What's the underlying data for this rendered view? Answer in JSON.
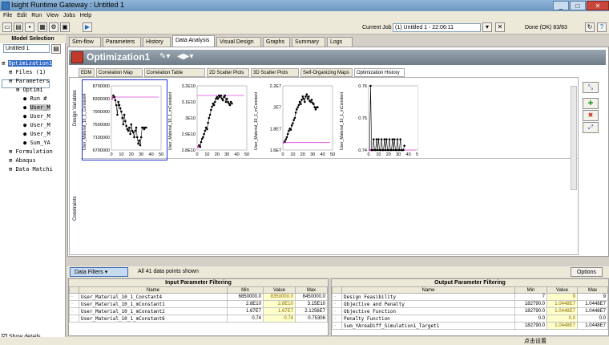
{
  "window": {
    "title": "Isight Runtime Gateway : Untitled 1"
  },
  "menu": [
    "File",
    "Edit",
    "Run",
    "View",
    "Jobs",
    "Help"
  ],
  "toolbar": {
    "current_job_label": "Current Job",
    "current_job_value": "(1) Untitled 1 - 22:06:11",
    "status": "Done (OK) 83/83"
  },
  "left": {
    "title": "Model Selection",
    "model_select": "Untitled 1",
    "tree": [
      {
        "label": "Optimization1",
        "indent": 0,
        "sel": true
      },
      {
        "label": "Files (1)",
        "indent": 1
      },
      {
        "label": "Parameters",
        "indent": 1
      },
      {
        "label": "Optimi",
        "indent": 2
      },
      {
        "label": "Run #",
        "indent": 3
      },
      {
        "label": "User_M",
        "indent": 3,
        "hl": true
      },
      {
        "label": "User_M",
        "indent": 3
      },
      {
        "label": "User_M",
        "indent": 3
      },
      {
        "label": "User_M",
        "indent": 3
      },
      {
        "label": "Sum_YA",
        "indent": 3
      },
      {
        "label": "Formulation",
        "indent": 1
      },
      {
        "label": "Abaqus",
        "indent": 1
      },
      {
        "label": "Data Matchi",
        "indent": 1
      }
    ],
    "show_details": "Show details"
  },
  "tabs": [
    "Sim-flow",
    "Parameters",
    "History",
    "Data Analysis",
    "Visual Design",
    "Graphs",
    "Summary",
    "Logs"
  ],
  "active_tab": "Data Analysis",
  "component_title": "Optimization1",
  "subtabs": [
    "EDM",
    "Correlation Map",
    "Correlation Table",
    "2D Scatter Plots",
    "3D Scatter Plots",
    "Self-Organizing Maps",
    "Optimization History"
  ],
  "active_subtab": "Optimization History",
  "side_labels": {
    "design": "Design Variables",
    "constraints": "Constraints"
  },
  "chart_data": [
    {
      "type": "scatter",
      "ylabel": "User_Material_10_1_Constant4",
      "yticks": [
        "8700000",
        "8300000",
        "7900000",
        "7500000",
        "7100000",
        "6700000"
      ],
      "ylim": [
        6700000,
        8700000
      ],
      "xticks": [
        "0",
        "10",
        "20",
        "30",
        "40",
        "50"
      ],
      "xlim": [
        0,
        50
      ],
      "ref": 8350000,
      "x": [
        1,
        2,
        3,
        4,
        5,
        6,
        7,
        8,
        9,
        10,
        11,
        12,
        13,
        14,
        15,
        16,
        17,
        18,
        19,
        20,
        21,
        22,
        23,
        24,
        25,
        26,
        27,
        28,
        29,
        30,
        31,
        32,
        33,
        34,
        35
      ],
      "y": [
        8300000,
        8400000,
        8350000,
        8250000,
        8100000,
        7800000,
        8200000,
        8100000,
        8000000,
        7900000,
        7700000,
        7500000,
        7800000,
        7600000,
        7450000,
        7350000,
        7300000,
        7400000,
        7200000,
        7500000,
        7300000,
        7250000,
        7100000,
        7300000,
        7400000,
        7100000,
        6900000,
        7000000,
        6850000,
        7100000,
        7400000,
        7400000,
        7350000,
        7400000,
        7400000
      ]
    },
    {
      "type": "scatter",
      "ylabel": "User_Material_10_1_mConstant",
      "yticks": [
        "3.2E10",
        "3.1E10",
        "3E10",
        "2.9E10",
        "2.8E10"
      ],
      "ylim": [
        28000000000.0,
        32000000000.0
      ],
      "xticks": [
        "0",
        "10",
        "20",
        "30",
        "40",
        "50"
      ],
      "xlim": [
        0,
        50
      ],
      "ref": 31400000000.0,
      "x": [
        1,
        2,
        3,
        4,
        5,
        6,
        7,
        8,
        9,
        10,
        11,
        12,
        13,
        14,
        15,
        16,
        17,
        18,
        19,
        20,
        21,
        22,
        23,
        24,
        25,
        26,
        27,
        28,
        29,
        30,
        31,
        32,
        33,
        34,
        35
      ],
      "y": [
        28200000000.0,
        28300000000.0,
        28200000000.0,
        28500000000.0,
        28700000000.0,
        28800000000.0,
        29000000000.0,
        29200000000.0,
        29400000000.0,
        29300000000.0,
        29700000000.0,
        30000000000.0,
        30200000000.0,
        30500000000.0,
        30700000000.0,
        30900000000.0,
        30800000000.0,
        31000000000.0,
        31200000000.0,
        31300000000.0,
        31200000000.0,
        31400000000.0,
        31300000000.0,
        31400000000.0,
        31200000000.0,
        31100000000.0,
        31300000000.0,
        31400000000.0,
        31000000000.0,
        31200000000.0,
        31000000000.0,
        30900000000.0,
        30800000000.0,
        31000000000.0,
        30900000000.0
      ]
    },
    {
      "type": "scatter",
      "ylabel": "User_Material_10_1_mConstant",
      "yticks": [
        "2.2E7",
        "2E7",
        "1.8E7",
        "1.6E7"
      ],
      "ylim": [
        16000000.0,
        22000000.0
      ],
      "xticks": [
        "0",
        "10",
        "20",
        "30",
        "40",
        "50"
      ],
      "xlim": [
        0,
        50
      ],
      "ref": 16700000.0,
      "x": [
        1,
        2,
        3,
        4,
        5,
        6,
        7,
        8,
        9,
        10,
        11,
        12,
        13,
        14,
        15,
        16,
        17,
        18,
        19,
        20,
        21,
        22,
        23,
        24,
        25,
        26,
        27,
        28,
        29,
        30,
        31,
        32,
        33,
        34,
        35
      ],
      "y": [
        16700000.0,
        16800000.0,
        17000000.0,
        17200000.0,
        17500000.0,
        17800000.0,
        18000000.0,
        17900000.0,
        18300000.0,
        18500000.0,
        18800000.0,
        19000000.0,
        19500000.0,
        19800000.0,
        20000000.0,
        20200000.0,
        20500000.0,
        20300000.0,
        20700000.0,
        21000000.0,
        20800000.0,
        20500000.0,
        21000000.0,
        21200000.0,
        20800000.0,
        21000000.0,
        20600000.0,
        20500000.0,
        20700000.0,
        20400000.0,
        20300000.0,
        20000000.0,
        19800000.0,
        20000000.0,
        20000000.0
      ]
    },
    {
      "type": "scatter",
      "ylabel": "User_Material_10_1_mConstant",
      "yticks": [
        "0.76",
        "0.75",
        "0.74"
      ],
      "ylim": [
        0.74,
        0.77
      ],
      "xticks": [
        "0",
        "10",
        "20",
        "30",
        "40",
        "50"
      ],
      "xlim": [
        0,
        50
      ],
      "ref": 0.74,
      "x": [
        1,
        2,
        3,
        4,
        5,
        6,
        7,
        8,
        9,
        10,
        11,
        12,
        13,
        14,
        15,
        16,
        17,
        18,
        19,
        20,
        21,
        22,
        23,
        24,
        25,
        26,
        27,
        28,
        29,
        30,
        31,
        32,
        33,
        34,
        35,
        36
      ],
      "y": [
        0.74,
        0.77,
        0.74,
        0.74,
        0.745,
        0.74,
        0.74,
        0.745,
        0.74,
        0.745,
        0.74,
        0.74,
        0.745,
        0.74,
        0.74,
        0.745,
        0.74,
        0.745,
        0.74,
        0.74,
        0.745,
        0.74,
        0.74,
        0.745,
        0.74,
        0.745,
        0.74,
        0.74,
        0.745,
        0.74,
        0.74,
        0.745,
        0.74,
        0.74,
        0.74,
        0.742
      ]
    }
  ],
  "filter": {
    "button": "Data Filters",
    "info": "All 41 data points shown",
    "options": "Options"
  },
  "input_panel": {
    "title": "Input Parameter Filtering",
    "headers": [
      "Name",
      "Min",
      "Value",
      "Max"
    ],
    "rows": [
      [
        "User_Material_10_1_Constant4",
        "6850000.0",
        "8350000.0",
        "8450000.0"
      ],
      [
        "User_Material_10_1_mConstant1",
        "2.8E10",
        "2.8E10",
        "3.15E10"
      ],
      [
        "User_Material_10_1_mConstant2",
        "1.67E7",
        "1.67E7",
        "2.1256E7"
      ],
      [
        "User_Material_10_1_mConstant6",
        "0.74",
        "0.74",
        "0.75306"
      ]
    ]
  },
  "output_panel": {
    "title": "Output Parameter Filtering",
    "headers": [
      "Name",
      "Min",
      "Value",
      "Max"
    ],
    "rows": [
      [
        "Design Feasibility",
        "7",
        "9",
        "9"
      ],
      [
        "Objective and Penalty",
        "182790.0",
        "1.0448E7",
        "1.0448E7"
      ],
      [
        "Objective Function",
        "182790.0",
        "1.0448E7",
        "1.0448E7"
      ],
      [
        "Penalty Function",
        "0.0",
        "0.0",
        "0.0"
      ],
      [
        "Sum_YAreaDiff_Simulation1_Target1",
        "182790.0",
        "1.0448E7",
        "1.0448E7"
      ]
    ]
  },
  "status": {
    "center": "点击设置"
  }
}
